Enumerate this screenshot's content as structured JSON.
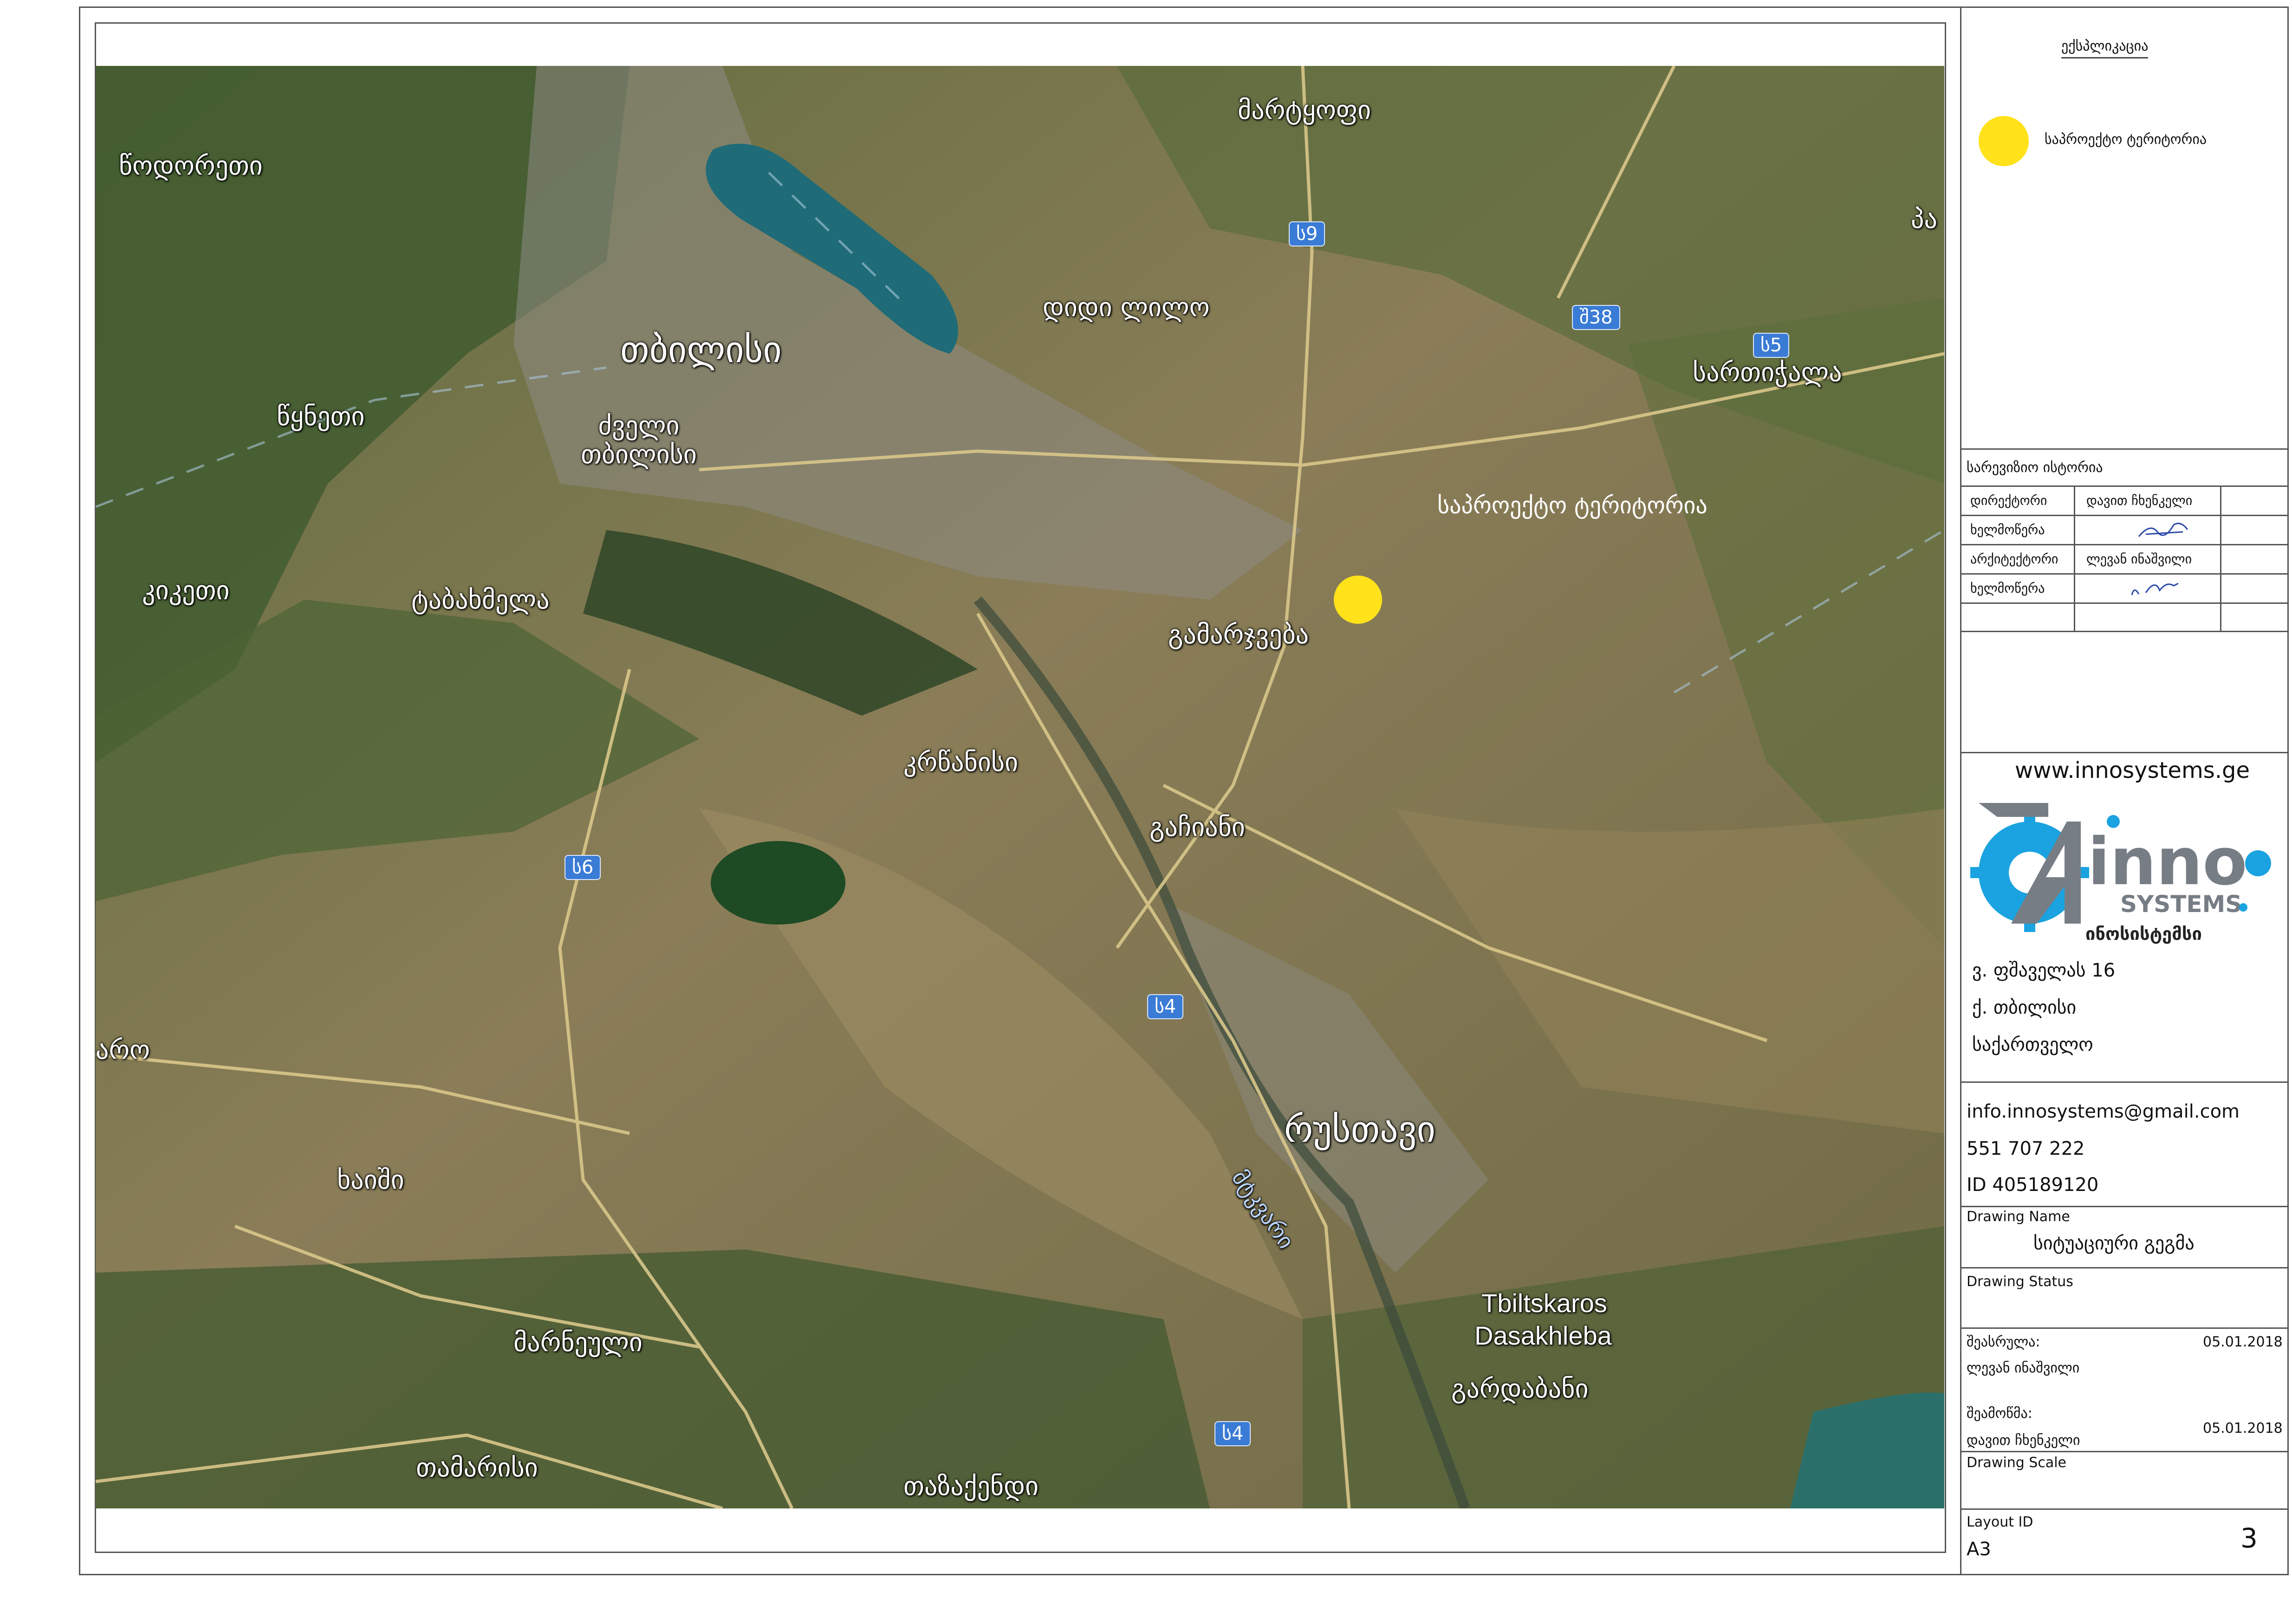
{
  "map": {
    "labels": {
      "tsodoreti": "წოდორეთი",
      "martkopi": "მარტყოფი",
      "didi_lilo": "დიდი ლილო",
      "tbilisi": "თბილისი",
      "sartichala": "სართიჭალა",
      "tsqneti": "წყნეთი",
      "dzveli_tbilisi": "ძველი თბილისი",
      "kiketi": "კიკეთი",
      "tabakhmela": "ტაბახმელა",
      "project_territory": "საპროექტო ტერიტორია",
      "gamarjveba": "გამარჯვება",
      "krtsanisi": "კრწანისი",
      "gachiani": "გაჩიანი",
      "rustavi": "რუსთავი",
      "mtkvari": "მტკვარი",
      "tbiltskaros": "Tbiltskaros",
      "dasakhleba": "Dasakhleba",
      "gardabani": "გარდაბანი",
      "khaishi": "ხაიში",
      "marneuli": "მარნეული",
      "tamarisi": "თამარისი",
      "tazakendi": "თაზაქენდი",
      "left_edge": "არო",
      "right_edge": "პა"
    },
    "shields": {
      "s9": "ს9",
      "sh38": "შ38",
      "s5": "ს5",
      "s6": "ს6",
      "s4a": "ს4",
      "s4b": "ს4"
    },
    "marker_color": "#ffe21a"
  },
  "legend": {
    "title": "ექსპლიკაცია",
    "item": "საპროექტო ტერიტორია"
  },
  "revision": {
    "title": "სარევიზიო ისტორია",
    "rows": [
      {
        "role": "დირექტორი",
        "name": "დავით ჩხენკელი"
      },
      {
        "role": "ხელმოწერა",
        "name": ""
      },
      {
        "role": "არქიტექტორი",
        "name": "ლევან ინაშვილი"
      },
      {
        "role": "ხელმოწერა",
        "name": ""
      }
    ]
  },
  "company": {
    "website": "www.innosystems.ge",
    "logo_word": "inno",
    "logo_sub": "SYSTEMS",
    "logo_geo": "ინოსისტემსი",
    "address_street": "ვ. ფშაველას 16",
    "address_city": "ქ. თბილისი",
    "address_country": "საქართველო",
    "email": "info.innosystems@gmail.com",
    "phone": "551 707 222",
    "id": "ID 405189120"
  },
  "drawing": {
    "name_label": "Drawing Name",
    "name": "სიტუაციური გეგმა",
    "status_label": "Drawing Status",
    "performed_label": "შეასრულა:",
    "performed_by": "ლევან ინაშვილი",
    "performed_date": "05.01.2018",
    "checked_label": "შეამოწმა:",
    "checked_by": "დავით ჩხენკელი",
    "checked_date": "05.01.2018",
    "scale_label": "Drawing Scale",
    "layout_label": "Layout ID",
    "layout_value": "A3",
    "sheet_number": "3"
  },
  "colors": {
    "marker": "#ffe21a",
    "logo_blue": "#1aa3e0",
    "logo_gray": "#777d85",
    "road_shield": "#3a7bd5"
  }
}
